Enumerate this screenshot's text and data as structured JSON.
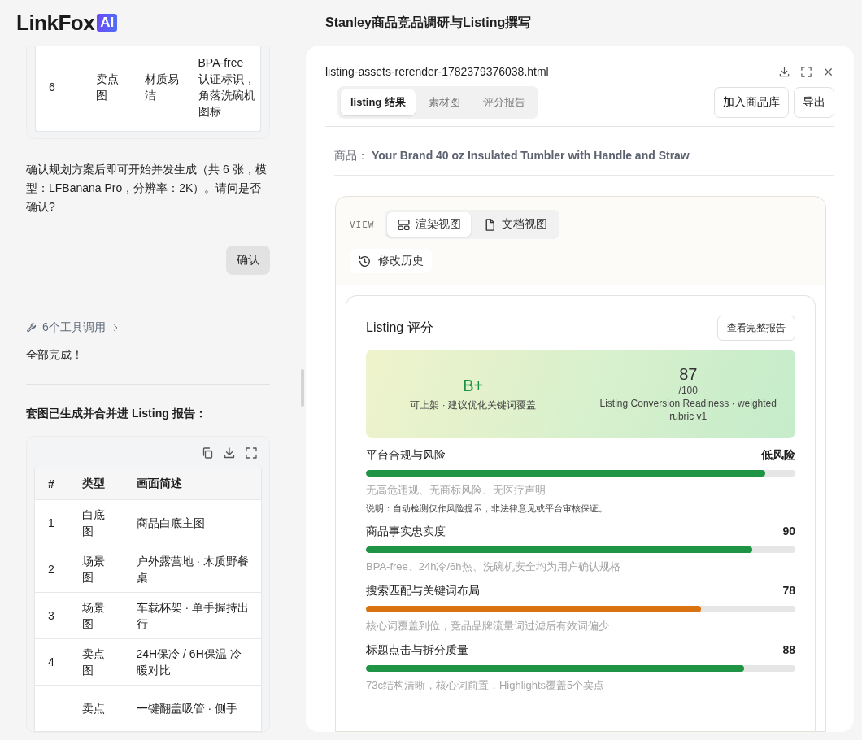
{
  "app": {
    "logo": "LinkFox",
    "logo_badge": "AI",
    "title": "Stanley商品竞品调研与Listing撰写"
  },
  "chat": {
    "plan_table": {
      "rows": [
        {
          "index": "6",
          "type": "卖点图",
          "column_3": "材质易洁",
          "column_4": "BPA-free 认证标识，角落洗碗机图标"
        }
      ]
    },
    "confirm_message": "确认规划方案后即可开始并发生成（共 6 张，模型：LFBanana Pro，分辨率：2K）。请问是否确认?",
    "user_reply": "确认",
    "tool_calls": "6个工具调用",
    "done_message": "全部完成！",
    "summary_heading": "套图已生成并合并进 Listing 报告：",
    "image_table": {
      "columns": [
        "#",
        "类型",
        "画面简述"
      ],
      "rows": [
        {
          "index": "1",
          "type": "白底图",
          "description": "商品白底主图"
        },
        {
          "index": "2",
          "type": "场景图",
          "description": "户外露营地 · 木质野餐桌"
        },
        {
          "index": "3",
          "type": "场景图",
          "description": "车载杯架 · 单手握持出行"
        },
        {
          "index": "4",
          "type": "卖点图",
          "description": "24H保冷 / 6H保温 冷暖对比"
        },
        {
          "type": "卖点",
          "description": "一键翻盖吸管 · 侧手"
        }
      ]
    }
  },
  "preview": {
    "file_name": "listing-assets-rerender-1782379376038.html",
    "tabs": [
      {
        "label": "listing 结果",
        "selected": true
      },
      {
        "label": "素材图",
        "selected": false
      },
      {
        "label": "评分报告",
        "selected": false
      }
    ],
    "actions": [
      "加入商品库",
      "导出"
    ],
    "product_label": "商品：",
    "product_name": "Your Brand 40 oz Insulated Tumbler with Handle and Straw",
    "view_label": "VIEW",
    "view_modes": [
      {
        "label": "渲染视图",
        "kind": "render",
        "selected": true
      },
      {
        "label": "文档视图",
        "kind": "document",
        "selected": false
      }
    ],
    "history_button": "修改历史",
    "score": {
      "title": "Listing 评分",
      "report_button": "查看完整报告",
      "grade": "B+",
      "grade_note": "可上架 · 建议优化关键词覆盖",
      "total": "87",
      "total_max": "/100",
      "rubric": "Listing Conversion Readiness · weighted rubric v1",
      "metrics": [
        {
          "name": "平台合规与风险",
          "value": "低风险",
          "level": 0.93,
          "color": "#1e9444",
          "description": "无高危违规、无商标风险、无医疗声明",
          "note": "说明：自动检测仅作风险提示，非法律意见或平台审核保证。"
        },
        {
          "name": "商品事实忠实度",
          "value": "90",
          "level": 0.9,
          "color": "#1e9444",
          "description": "BPA-free、24h冷/6h热、洗碗机安全均为用户确认规格"
        },
        {
          "name": "搜索匹配与关键词布局",
          "value": "78",
          "level": 0.78,
          "color": "#d9720f",
          "description": "核心词覆盖到位，竞品品牌流量词过滤后有效词偏少"
        },
        {
          "name": "标题点击与拆分质量",
          "value": "88",
          "level": 0.88,
          "color": "#1e9444",
          "description": "73c结构清晰，核心词前置，Highlights覆盖5个卖点"
        }
      ]
    }
  }
}
